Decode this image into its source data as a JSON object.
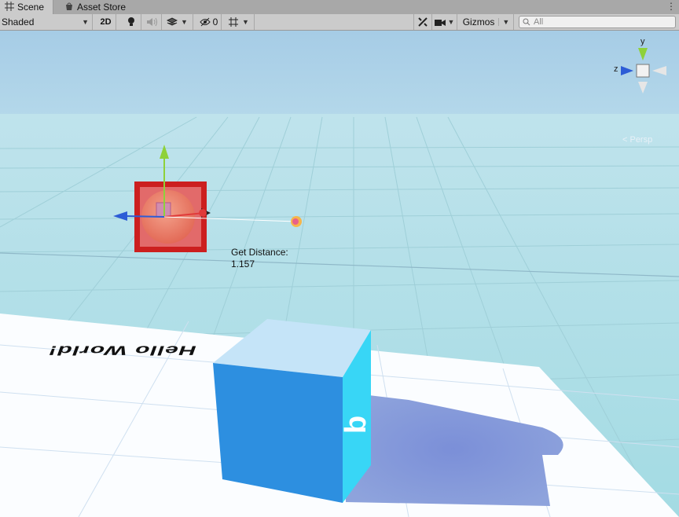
{
  "tabs": [
    {
      "label": "Scene",
      "icon": "grid-icon",
      "active": true
    },
    {
      "label": "Asset Store",
      "icon": "store-icon",
      "active": false
    }
  ],
  "toolbar": {
    "shading_mode": "Shaded",
    "mode_2d": "2D",
    "hidden_count": "0",
    "gizmos": "Gizmos",
    "search_placeholder": "All"
  },
  "scene": {
    "distance_label": "Get Distance:",
    "distance_value": "1.157",
    "projection": "< Persp",
    "axis_y": "y",
    "axis_z": "z",
    "floor_text": "Hello World!",
    "cube_glyph": "b"
  },
  "colors": {
    "sky": "#a9cde6",
    "grid_floor": "#aee0e6",
    "cube_front": "#2d8fe0",
    "cube_side": "#38d6f6",
    "cube_top": "#c5e4f8",
    "selection_red": "#cc1f1f",
    "axis_y": "#8ed13a",
    "axis_x": "#e03a3a",
    "axis_z": "#2d5cd6"
  }
}
